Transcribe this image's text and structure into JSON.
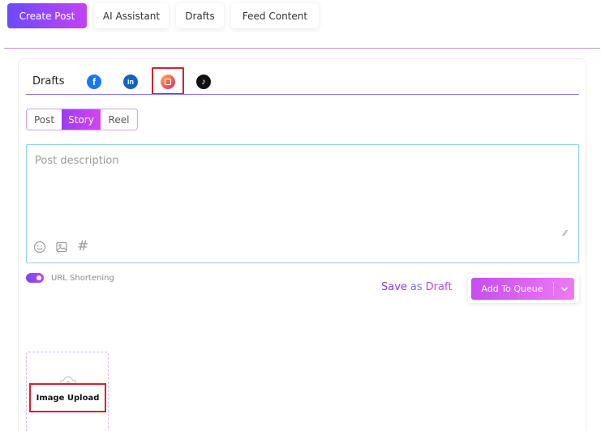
{
  "topbar": {
    "create_post": "Create Post",
    "ai_assistant": "AI Assistant",
    "drafts": "Drafts",
    "feed_content": "Feed Content"
  },
  "tabs": {
    "drafts": "Drafts",
    "facebook_glyph": "f",
    "linkedin_glyph": "in",
    "tiktok_glyph": "♪",
    "icons": [
      "facebook-icon",
      "linkedin-icon",
      "instagram-icon",
      "tiktok-icon"
    ]
  },
  "post_type": {
    "options": [
      "Post",
      "Story",
      "Reel"
    ],
    "selected": "Story"
  },
  "editor": {
    "placeholder": "Post description",
    "tools": [
      "emoji-icon",
      "image-icon",
      "hashtag-icon"
    ],
    "hashtag_glyph": "#"
  },
  "url_shortening": {
    "label": "URL Shortening",
    "enabled": true
  },
  "actions": {
    "save_word": "Save",
    "as_word": "as",
    "draft_word": "Draft",
    "add_to_queue": "Add To Queue"
  },
  "upload": {
    "label": "Image Upload"
  },
  "colors": {
    "accent": "#9b3cf2",
    "highlight_box": "#d6212b"
  }
}
